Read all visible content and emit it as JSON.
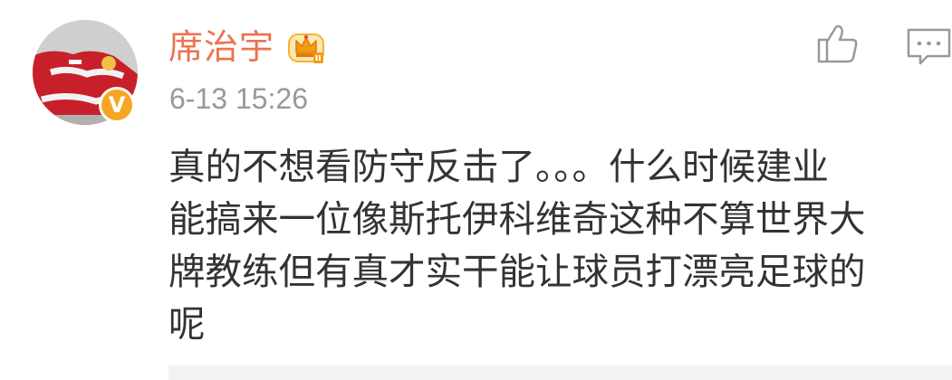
{
  "comment": {
    "username": "席治宇",
    "timestamp": "6-13 15:26",
    "text": "真的不想看防守反击了。。。什么时候建业\n能搞来一位像斯托伊科维奇这种不算世界大\n牌教练但有真才实干能让球员打漂亮足球的\n呢",
    "verified_badge_letter": "V"
  },
  "icons": {
    "vip": "crown-icon",
    "like": "thumbs-up-icon",
    "reply": "comment-icon"
  },
  "colors": {
    "username": "#eb7350",
    "timestamp": "#999999",
    "body_text": "#333333",
    "badge": "#f6a623",
    "icon_stroke": "#999999"
  }
}
